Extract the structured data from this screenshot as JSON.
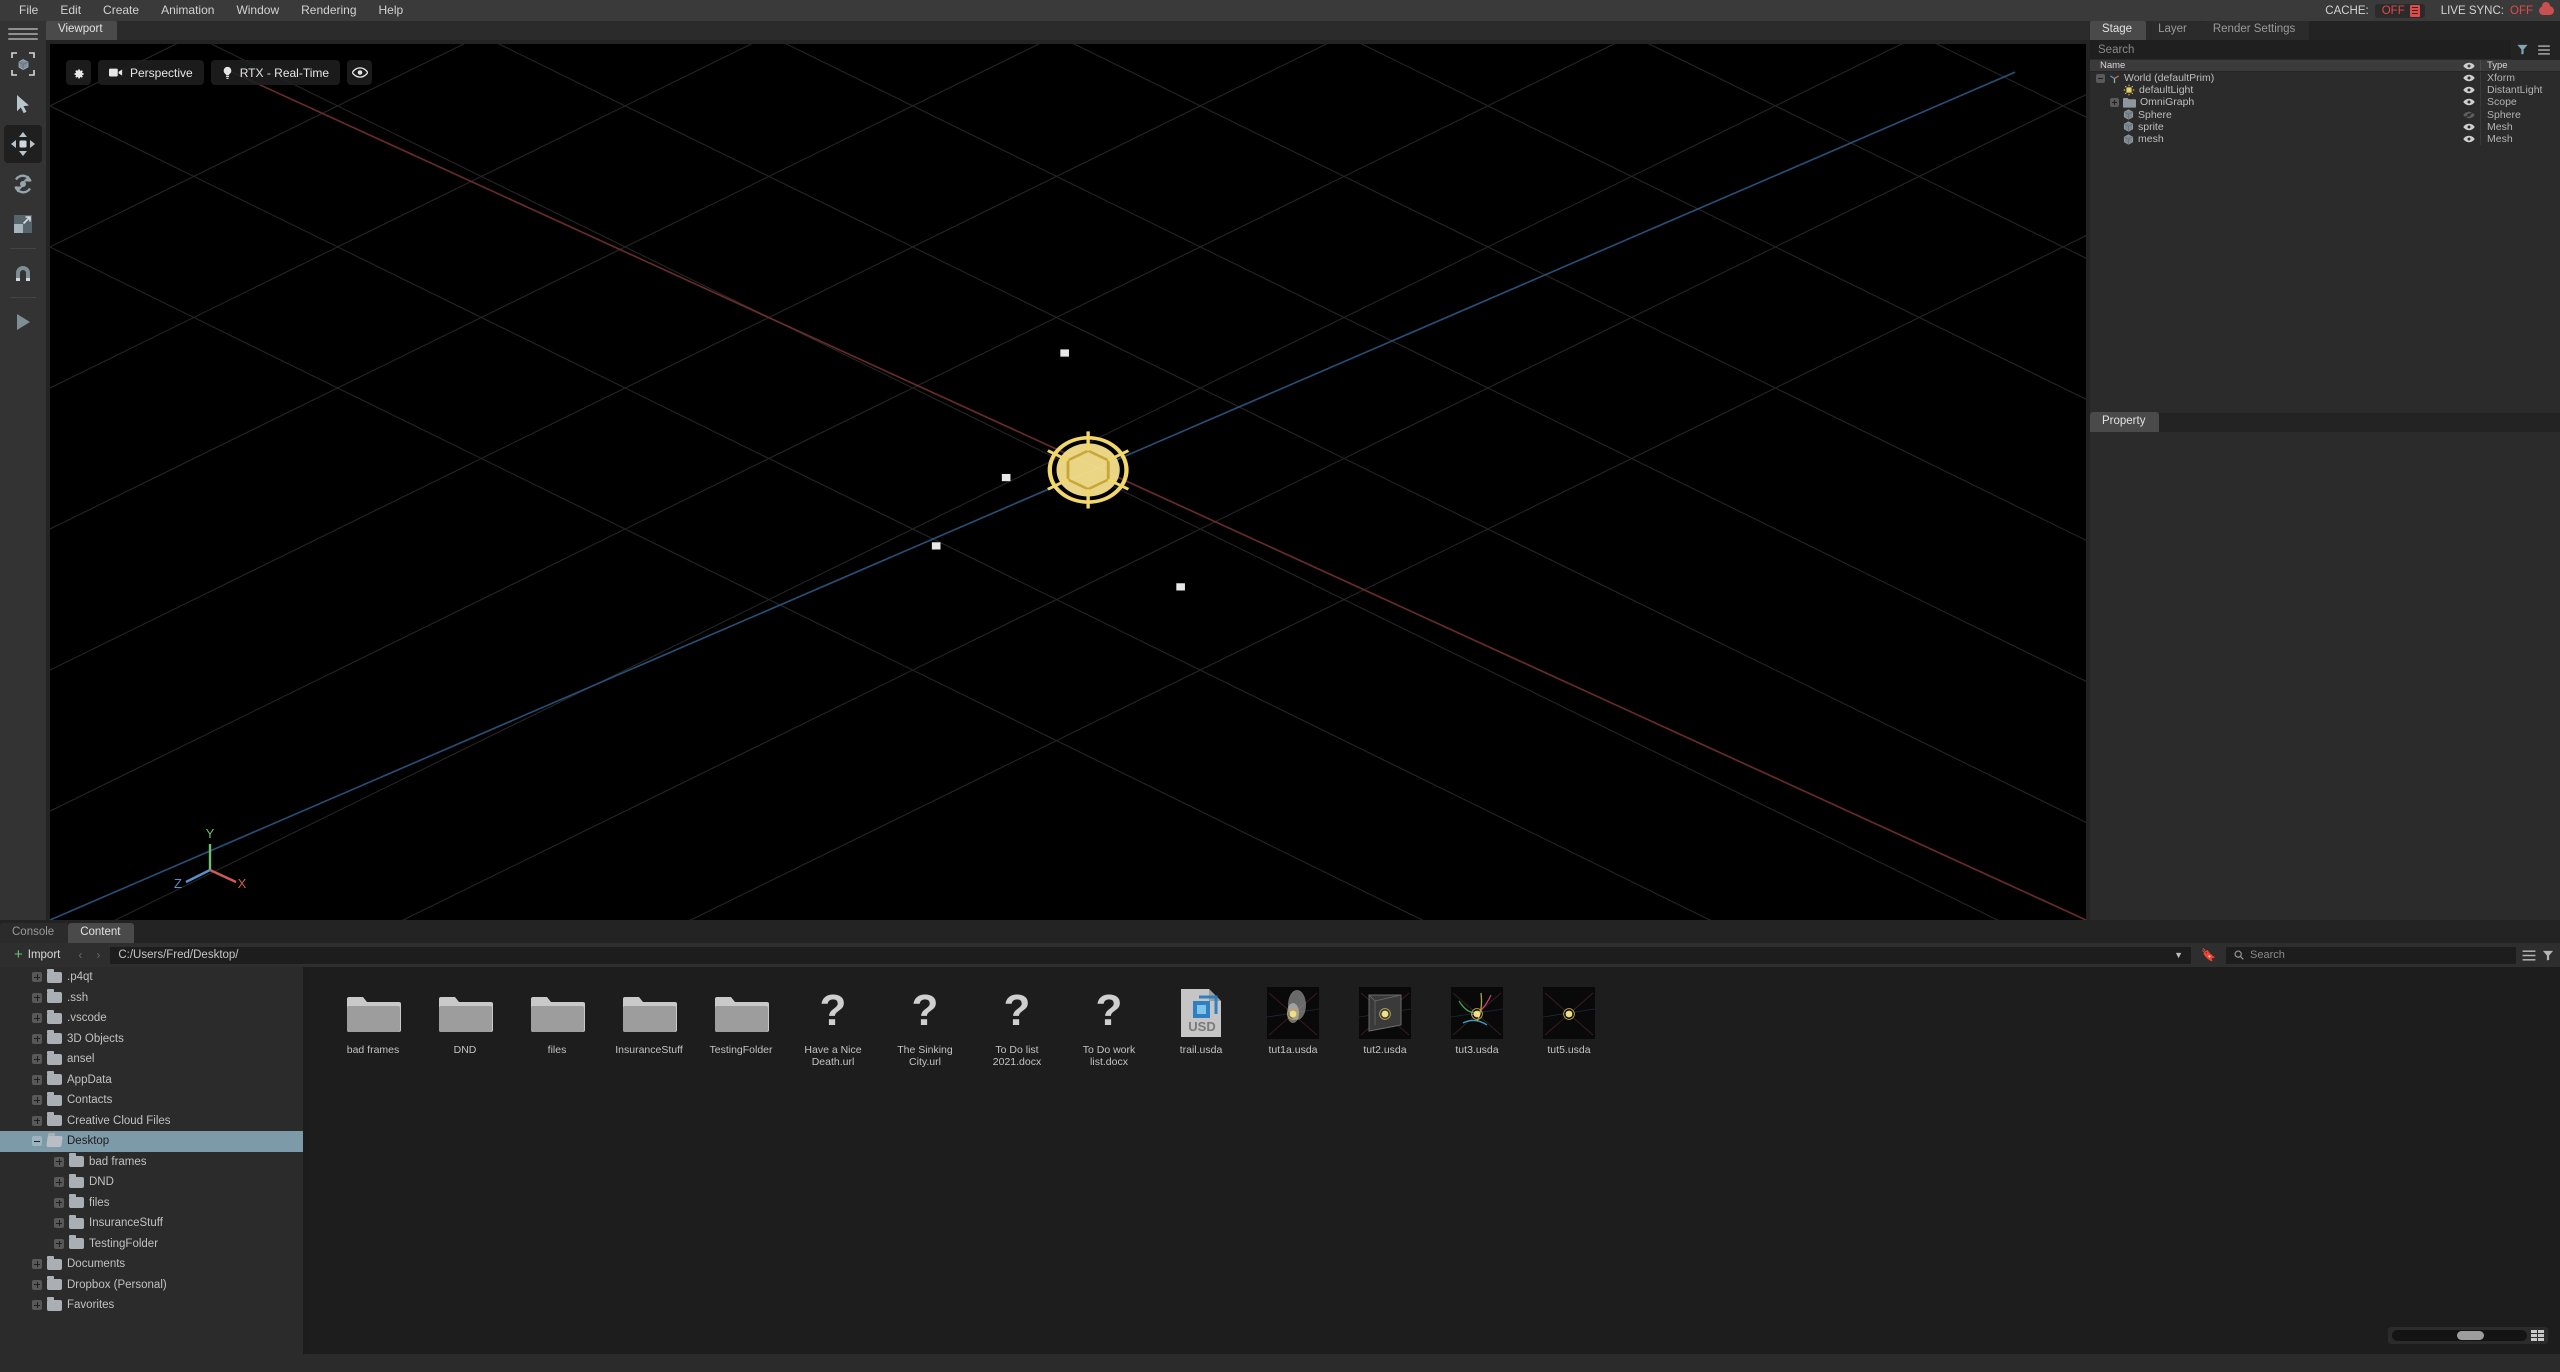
{
  "menubar": {
    "items": [
      "File",
      "Edit",
      "Create",
      "Animation",
      "Window",
      "Rendering",
      "Help"
    ],
    "cache": {
      "label": "CACHE:",
      "value": "OFF",
      "icon": "document-icon",
      "color": "#e04a4a"
    },
    "live_sync": {
      "label": "LIVE SYNC:",
      "value": "OFF",
      "icon": "cloud-icon",
      "color": "#c85050"
    }
  },
  "toolbar": {
    "items": [
      {
        "name": "menu-hamburger",
        "icon": "hamburger-icon"
      },
      {
        "name": "select-bounds",
        "icon": "selection-box-icon"
      },
      {
        "name": "select-tool",
        "icon": "cursor-arrow-icon"
      },
      {
        "name": "move-tool",
        "icon": "move-arrows-icon",
        "active": true
      },
      {
        "name": "rotate-tool",
        "icon": "rotate-icon"
      },
      {
        "name": "scale-tool",
        "icon": "scale-icon"
      },
      {
        "name": "snap-tool",
        "icon": "magnet-icon"
      },
      {
        "name": "play-tool",
        "icon": "play-icon"
      }
    ]
  },
  "viewport": {
    "tab": "Viewport",
    "settings_label": "",
    "camera": "Perspective",
    "renderer": "RTX - Real-Time",
    "axis": {
      "x": "X",
      "y": "Y",
      "z": "Z",
      "x_color": "#d05a5a",
      "y_color": "#6fbf6f",
      "z_color": "#5a8fd0"
    }
  },
  "stage": {
    "tabs": [
      {
        "label": "Stage",
        "active": true
      },
      {
        "label": "Layer",
        "active": false
      },
      {
        "label": "Render Settings",
        "active": false
      }
    ],
    "search_placeholder": "Search",
    "search_value": "",
    "columns": {
      "name": "Name",
      "type": "Type"
    },
    "rows": [
      {
        "label": "World (defaultPrim)",
        "type": "Xform",
        "indent": 0,
        "expander": "minus",
        "icon": "axis-icon",
        "visible": true
      },
      {
        "label": "defaultLight",
        "type": "DistantLight",
        "indent": 1,
        "expander": "none",
        "icon": "light-icon",
        "visible": true
      },
      {
        "label": "OmniGraph",
        "type": "Scope",
        "indent": 1,
        "expander": "plus",
        "icon": "folder-icon",
        "visible": true
      },
      {
        "label": "Sphere",
        "type": "Sphere",
        "indent": 1,
        "expander": "none",
        "icon": "cube-icon",
        "visible": false
      },
      {
        "label": "sprite",
        "type": "Mesh",
        "indent": 1,
        "expander": "none",
        "icon": "cube-icon",
        "visible": true
      },
      {
        "label": "mesh",
        "type": "Mesh",
        "indent": 1,
        "expander": "none",
        "icon": "cube-icon",
        "visible": true
      }
    ]
  },
  "property": {
    "tabs": [
      {
        "label": "Property",
        "active": true
      }
    ]
  },
  "bottom": {
    "tabs": [
      {
        "label": "Console",
        "active": false
      },
      {
        "label": "Content",
        "active": true
      }
    ],
    "import_label": "Import",
    "path": "C:/Users/Fred/Desktop/",
    "search_placeholder": "Search",
    "folder_tree": [
      {
        "label": ".p4qt",
        "indent": 1,
        "expander": "plus",
        "selected": false
      },
      {
        "label": ".ssh",
        "indent": 1,
        "expander": "plus",
        "selected": false
      },
      {
        "label": ".vscode",
        "indent": 1,
        "expander": "plus",
        "selected": false
      },
      {
        "label": "3D Objects",
        "indent": 1,
        "expander": "plus",
        "selected": false
      },
      {
        "label": "ansel",
        "indent": 1,
        "expander": "plus",
        "selected": false
      },
      {
        "label": "AppData",
        "indent": 1,
        "expander": "plus",
        "selected": false
      },
      {
        "label": "Contacts",
        "indent": 1,
        "expander": "plus",
        "selected": false
      },
      {
        "label": "Creative Cloud Files",
        "indent": 1,
        "expander": "plus",
        "selected": false
      },
      {
        "label": "Desktop",
        "indent": 1,
        "expander": "minus",
        "selected": true
      },
      {
        "label": "bad frames",
        "indent": 2,
        "expander": "plus",
        "selected": false
      },
      {
        "label": "DND",
        "indent": 2,
        "expander": "plus",
        "selected": false
      },
      {
        "label": "files",
        "indent": 2,
        "expander": "plus",
        "selected": false
      },
      {
        "label": "InsuranceStuff",
        "indent": 2,
        "expander": "plus",
        "selected": false
      },
      {
        "label": "TestingFolder",
        "indent": 2,
        "expander": "plus",
        "selected": false
      },
      {
        "label": "Documents",
        "indent": 1,
        "expander": "plus",
        "selected": false
      },
      {
        "label": "Dropbox (Personal)",
        "indent": 1,
        "expander": "plus",
        "selected": false
      },
      {
        "label": "Favorites",
        "indent": 1,
        "expander": "plus",
        "selected": false
      }
    ],
    "files": [
      {
        "name": "bad frames",
        "kind": "folder"
      },
      {
        "name": "DND",
        "kind": "folder"
      },
      {
        "name": "files",
        "kind": "folder"
      },
      {
        "name": "InsuranceStuff",
        "kind": "folder"
      },
      {
        "name": "TestingFolder",
        "kind": "folder"
      },
      {
        "name": "Have a Nice Death.url",
        "kind": "unknown"
      },
      {
        "name": "The Sinking City.url",
        "kind": "unknown"
      },
      {
        "name": "To Do list 2021.docx",
        "kind": "unknown"
      },
      {
        "name": "To Do work list.docx",
        "kind": "unknown"
      },
      {
        "name": "trail.usda",
        "kind": "usd"
      },
      {
        "name": "tut1a.usda",
        "kind": "thumb-smoke"
      },
      {
        "name": "tut2.usda",
        "kind": "thumb-box"
      },
      {
        "name": "tut3.usda",
        "kind": "thumb-curves"
      },
      {
        "name": "tut5.usda",
        "kind": "thumb-star"
      }
    ],
    "zoom_slider": 48
  }
}
